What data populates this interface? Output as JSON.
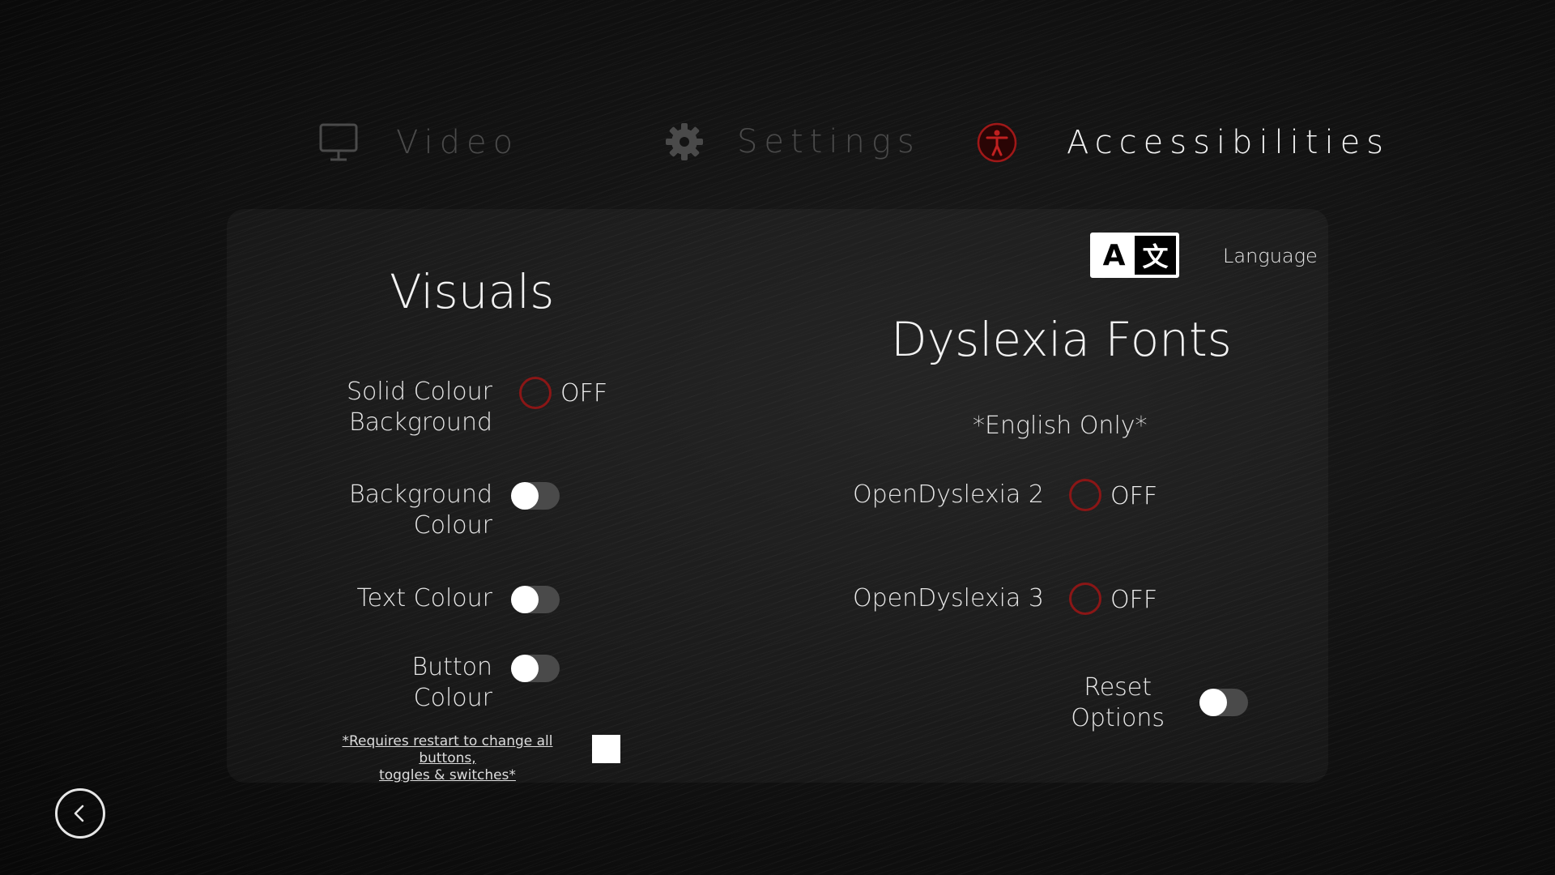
{
  "tabs": [
    {
      "label": "Video",
      "icon": "monitor-icon",
      "active": false
    },
    {
      "label": "Settings",
      "icon": "gear-icon",
      "active": false
    },
    {
      "label": "Accessibilities",
      "icon": "accessibility-icon",
      "active": true
    }
  ],
  "visuals": {
    "title": "Visuals",
    "solid_colour_background": {
      "line1": "Solid Colour",
      "line2": "Background",
      "state": "OFF"
    },
    "background_colour": {
      "line1": "Background",
      "line2": "Colour",
      "enabled": false
    },
    "text_colour": {
      "label": "Text Colour",
      "enabled": false
    },
    "button_colour": {
      "line1": "Button",
      "line2": "Colour",
      "enabled": false
    },
    "note_line1": "*Requires restart to change all buttons,",
    "note_line2": "toggles & switches*",
    "swatch_color": "#ffffff"
  },
  "language": {
    "label": "Language",
    "icon": "language-icon",
    "glyph_left": "A",
    "glyph_right": "文"
  },
  "dyslexia": {
    "title": "Dyslexia Fonts",
    "subtitle": "*English Only*",
    "open_dyslexia_2": {
      "label": "OpenDyslexia 2",
      "state": "OFF"
    },
    "open_dyslexia_3": {
      "label": "OpenDyslexia 3",
      "state": "OFF"
    },
    "reset": {
      "line1": "Reset",
      "line2": "Options",
      "enabled": false
    }
  },
  "colors": {
    "accent_red": "#8b1616",
    "toggle_track": "#4a4a4a",
    "background": "#0d0d0d"
  }
}
